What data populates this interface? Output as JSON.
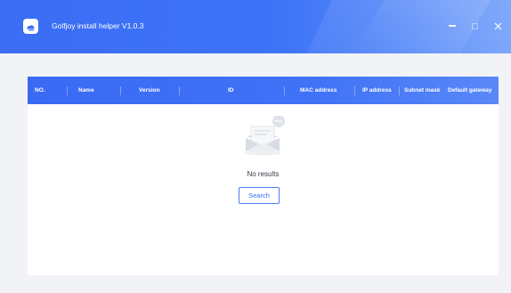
{
  "window": {
    "title": "Golfjoy install helper V1.0.3",
    "logo_icon": "cloud-device-icon",
    "controls": {
      "minimize": "minimize-icon",
      "maximize": "maximize-icon",
      "close": "close-icon"
    },
    "accent_color": "#3d6ff5"
  },
  "table": {
    "columns": [
      "NO.",
      "Name",
      "Version",
      "ID",
      "MAC address",
      "IP address",
      "Subnet mask",
      "Default gateway"
    ],
    "rows": []
  },
  "empty_state": {
    "icon": "empty-inbox-icon",
    "message": "No results",
    "search_label": "Search"
  }
}
